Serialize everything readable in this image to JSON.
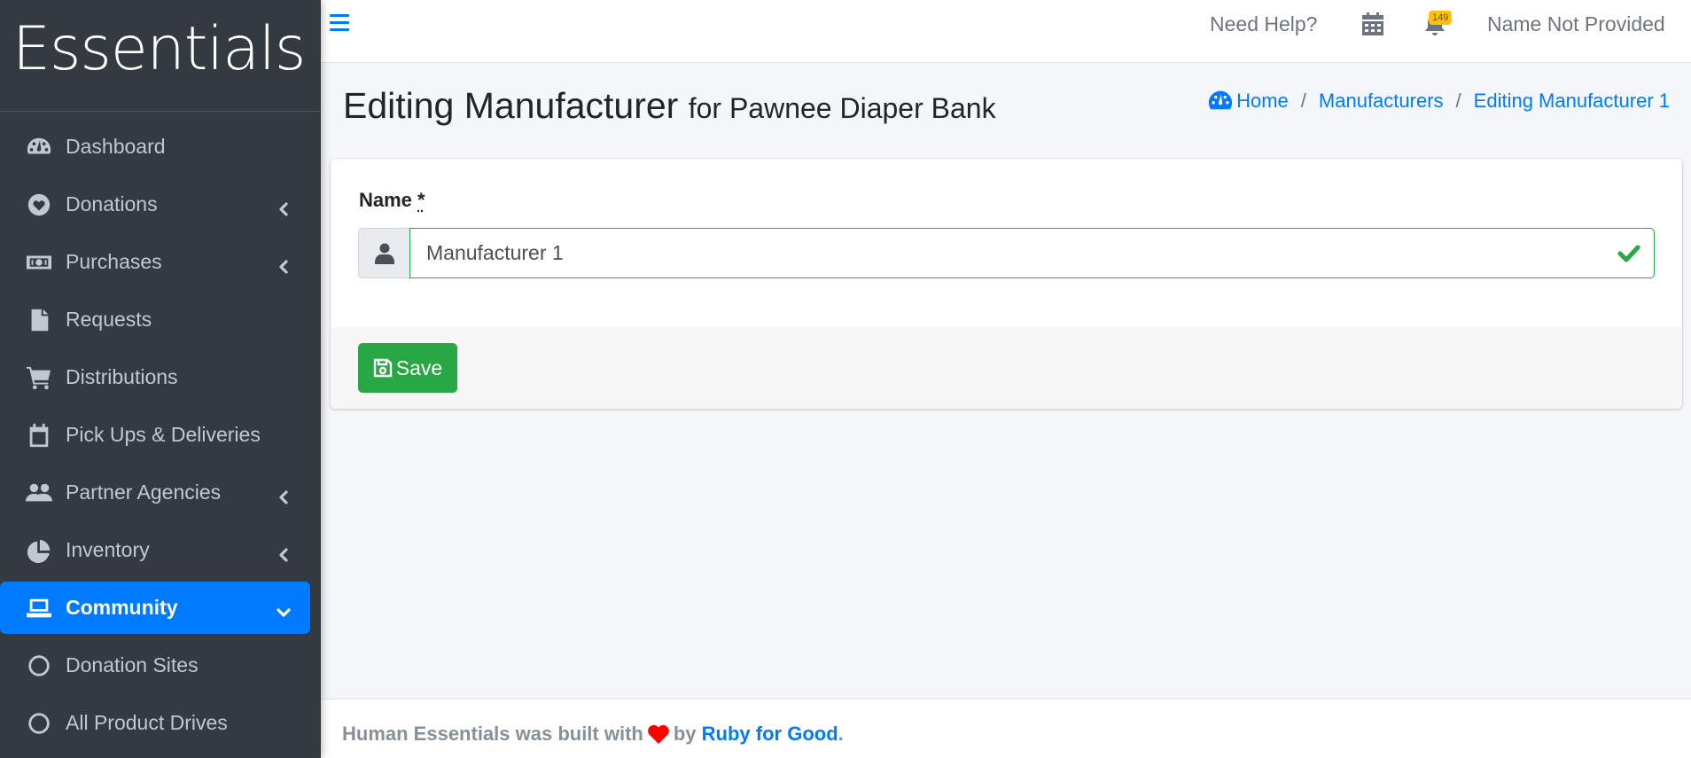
{
  "sidebar": {
    "brand": "Essentials",
    "items": [
      {
        "label": "Dashboard",
        "icon": "dashboard-gauge-icon",
        "expandable": false
      },
      {
        "label": "Donations",
        "icon": "heart-circle-icon",
        "expandable": true
      },
      {
        "label": "Purchases",
        "icon": "money-bill-icon",
        "expandable": true
      },
      {
        "label": "Requests",
        "icon": "file-icon",
        "expandable": false
      },
      {
        "label": "Distributions",
        "icon": "shopping-cart-icon",
        "expandable": false
      },
      {
        "label": "Pick Ups & Deliveries",
        "icon": "calendar-icon",
        "expandable": false
      },
      {
        "label": "Partner Agencies",
        "icon": "users-icon",
        "expandable": true
      },
      {
        "label": "Inventory",
        "icon": "pie-chart-icon",
        "expandable": true
      },
      {
        "label": "Community",
        "icon": "laptop-icon",
        "expandable": true,
        "active": true
      },
      {
        "label": "Donation Sites",
        "icon": "circle-icon",
        "expandable": false
      },
      {
        "label": "All Product Drives",
        "icon": "circle-icon",
        "expandable": false
      }
    ]
  },
  "topbar": {
    "help": "Need Help?",
    "notification_count": "149",
    "user_name": "Name Not Provided"
  },
  "header": {
    "title": "Editing Manufacturer",
    "subtitle": "for Pawnee Diaper Bank",
    "breadcrumbs": [
      "Home",
      "Manufacturers",
      "Editing Manufacturer 1"
    ]
  },
  "form": {
    "name_label": "Name",
    "required_marker": "*",
    "name_value": "Manufacturer 1",
    "save_label": "Save"
  },
  "footer": {
    "prefix": "Human Essentials was built with",
    "by": "by",
    "link": "Ruby for Good",
    "suffix": "."
  },
  "colors": {
    "primary": "#007bff",
    "success": "#28a745",
    "sidebar_bg": "#343a40",
    "badge": "#ffc107"
  }
}
